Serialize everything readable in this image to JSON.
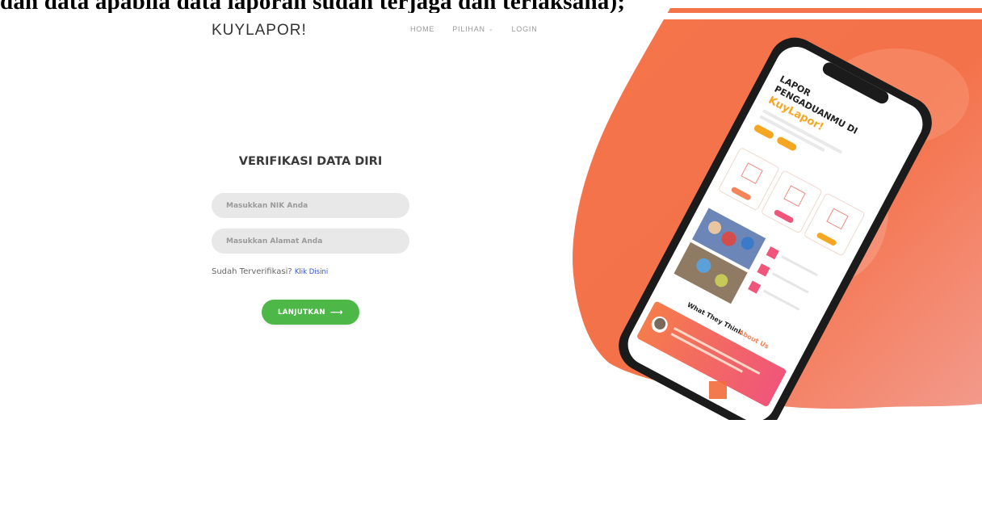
{
  "document": {
    "caption": "dan data apabila data laporan sudah terjaga dan terlaksana);"
  },
  "header": {
    "brand": "KUYLAPOR!",
    "nav": [
      {
        "label": "HOME"
      },
      {
        "label": "PILIHAN",
        "has_dropdown": true
      },
      {
        "label": "LOGIN"
      }
    ]
  },
  "form": {
    "title": "VERIFIKASI DATA DIRI",
    "nik_placeholder": "Masukkan NIK Anda",
    "address_placeholder": "Masukkan Alamat Anda",
    "verified_text": "Sudah Terverifikasi?",
    "verified_link": "Klik Disini",
    "submit_label": "LANJUTKAN",
    "submit_icon": "arrow-right-icon"
  },
  "hero_phone": {
    "headline_line1": "LAPOR",
    "headline_line2": "PENGADUANMU DI",
    "headline_brand": "KuyLapor!",
    "testimonial_title": "What They Think",
    "testimonial_accent": "About Us"
  },
  "colors": {
    "accent_green": "#4db848",
    "hero_orange": "#f26b3a",
    "hero_pink": "#f08080",
    "brand_yellow": "#f5a623",
    "link_blue": "#3355cc"
  }
}
